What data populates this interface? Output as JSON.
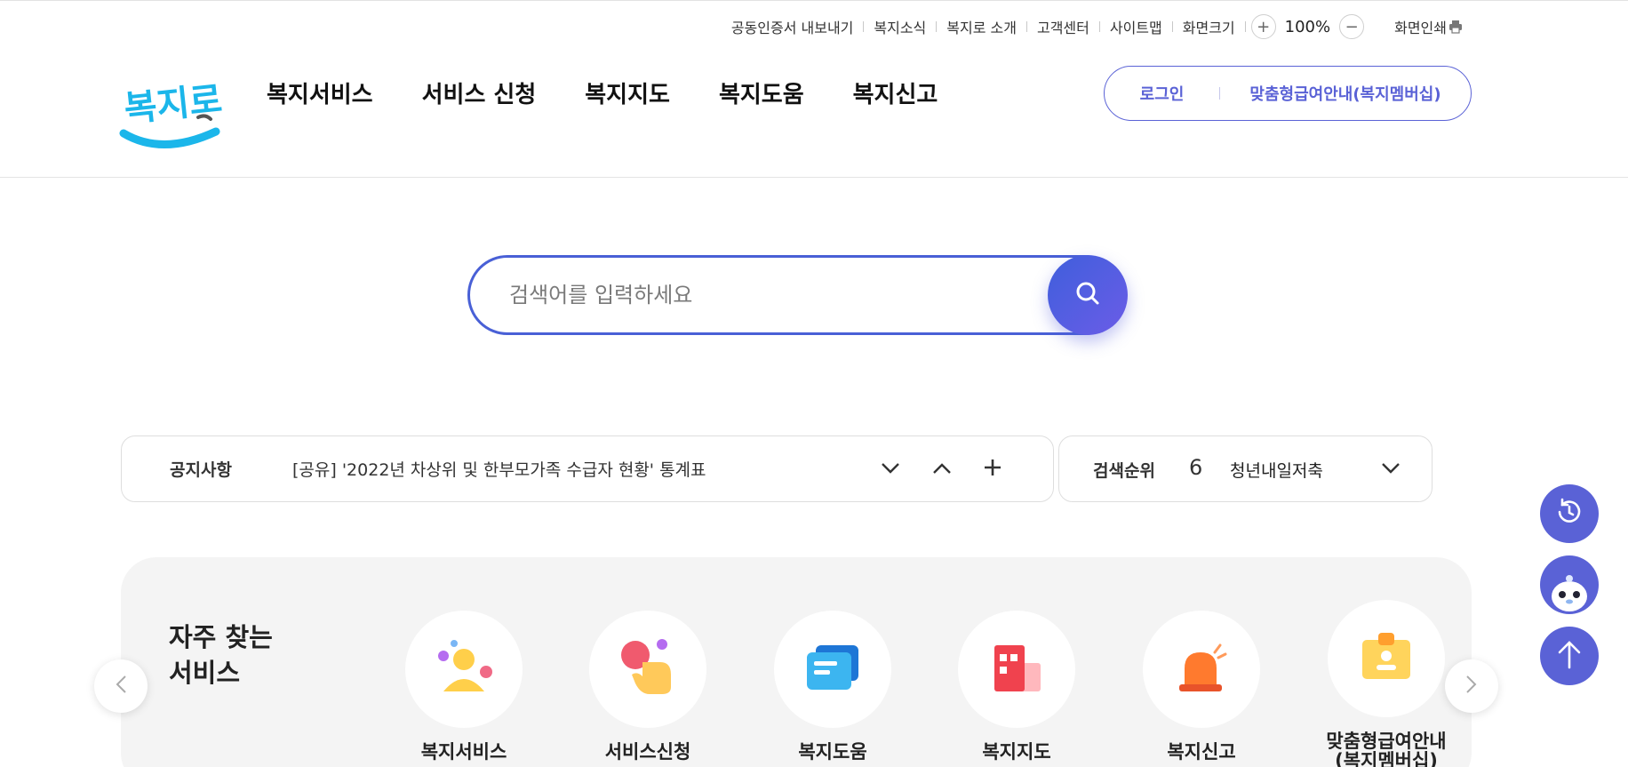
{
  "utility": {
    "links": [
      "공동인증서 내보내기",
      "복지소식",
      "복지로 소개",
      "고객센터",
      "사이트맵",
      "화면크기"
    ],
    "zoom_in": "+",
    "zoom_value": "100%",
    "zoom_out": "−",
    "print_label": "화면인쇄"
  },
  "logo": {
    "text": "복지로"
  },
  "gnb": [
    "복지서비스",
    "서비스 신청",
    "복지지도",
    "복지도움",
    "복지신고"
  ],
  "member": {
    "login": "로그인",
    "custom": "맞춤형급여안내(복지멤버십)"
  },
  "search": {
    "placeholder": "검색어를 입력하세요"
  },
  "notice": {
    "label": "공지사항",
    "text": "[공유] '2022년 차상위 및 한부모가족 수급자 현황' 통계표"
  },
  "rank": {
    "label": "검색순위",
    "number": "6",
    "term": "청년내일저축"
  },
  "frequent": {
    "title": "자주 찾는\n서비스",
    "items": [
      {
        "label": "복지서비스",
        "icon": "person-icon"
      },
      {
        "label": "서비스신청",
        "icon": "hand-tap-icon"
      },
      {
        "label": "복지도움",
        "icon": "message-icon"
      },
      {
        "label": "복지지도",
        "icon": "building-icon"
      },
      {
        "label": "복지신고",
        "icon": "siren-icon"
      },
      {
        "label": "맞춤형급여안내\n(복지멤버십)",
        "icon": "id-card-icon"
      }
    ]
  },
  "colors": {
    "accent": "#5a62d6",
    "search_border": "#4960d6",
    "logo_blue": "#1bb6ea"
  }
}
